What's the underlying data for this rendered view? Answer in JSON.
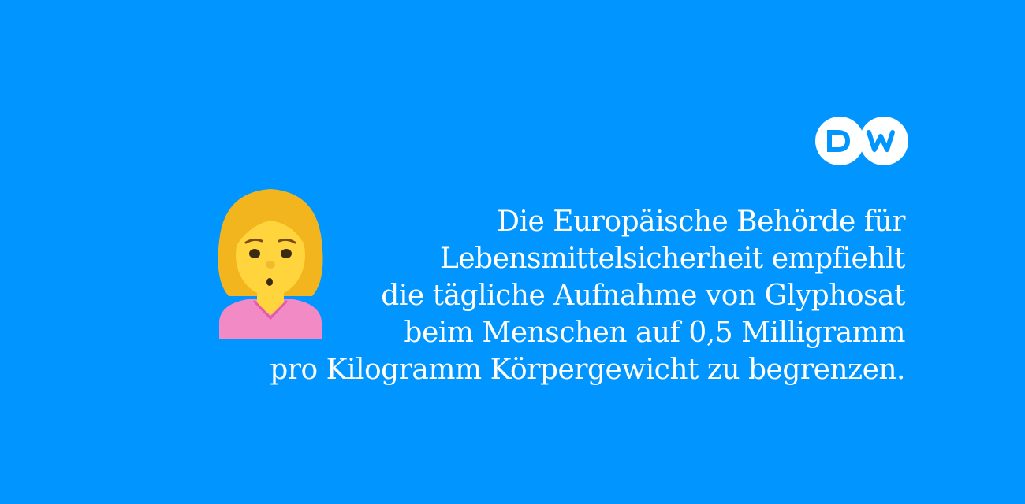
{
  "colors": {
    "background": "#0095ff",
    "text": "#ffffff",
    "logo_fill": "#ffffff",
    "logo_letters": "#0095ff",
    "emoji_hair": "#f2b51d",
    "emoji_face": "#ffd43d",
    "emoji_shirt": "#f28ac6"
  },
  "logo": {
    "text": "DW",
    "icon": "dw-logo"
  },
  "emoji": {
    "icon": "woman-pouting-emoji"
  },
  "quote": {
    "lines": [
      "Die Europäische Behörde für",
      "Lebensmittelsicherheit empfiehlt",
      "die tägliche Aufnahme von Glyphosat",
      "beim Menschen auf 0,5 Milligramm",
      "pro Kilogramm Körpergewicht zu begrenzen."
    ]
  }
}
